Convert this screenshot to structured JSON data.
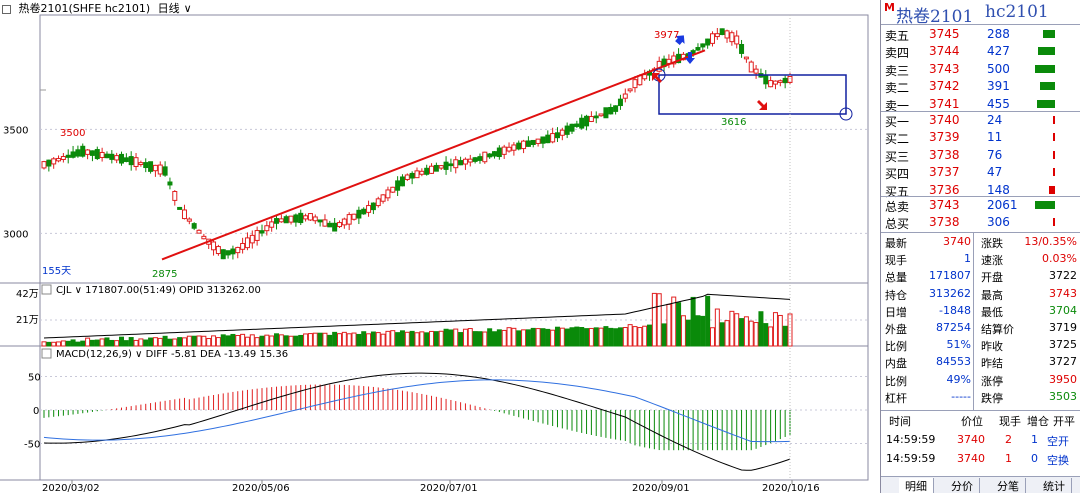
{
  "title": {
    "name": "热卷2101(SHFE hc2101)",
    "period": "日线",
    "arrow": "chevron-down-icon"
  },
  "chart_data": {
    "type": "candlestick",
    "x_ticks": [
      "2020/03/02",
      "2020/05/06",
      "2020/07/01",
      "2020/09/01",
      "2020/10/16"
    ],
    "price_axis": {
      "ticks": [
        "3500",
        "3000"
      ],
      "range": [
        2800,
        4050
      ]
    },
    "annotations": {
      "high1": "3500",
      "low": "2875",
      "high2": "3977",
      "box_low": "3616",
      "days": "155天"
    },
    "volume": {
      "label": "CJL",
      "value": "171807.00(51:49)",
      "opi_label": "OPID",
      "opi_value": "313262.00",
      "ticks": [
        "42万",
        "21万"
      ]
    },
    "macd": {
      "label": "MACD(12,26,9)",
      "diff_label": "DIFF",
      "diff": "-5.81",
      "dea_label": "DEA",
      "dea": "-13.49",
      "hist": "15.36",
      "ticks": [
        "50",
        "0",
        "-50"
      ]
    },
    "colors": {
      "up": "#e02020",
      "down": "#0a8a0a",
      "trend": "#e01010",
      "box": "#1020a0",
      "vol_line": "#000000",
      "diff_line": "#000000",
      "dea_line": "#3070e0"
    }
  },
  "panel": {
    "title_marker": "M",
    "title": "热卷2101",
    "code": "hc2101",
    "asks": [
      {
        "label": "卖五",
        "price": "3745",
        "vol": "288",
        "bar": 0.55
      },
      {
        "label": "卖四",
        "price": "3744",
        "vol": "427",
        "bar": 0.75
      },
      {
        "label": "卖三",
        "price": "3743",
        "vol": "500",
        "bar": 0.9
      },
      {
        "label": "卖二",
        "price": "3742",
        "vol": "391",
        "bar": 0.7
      },
      {
        "label": "卖一",
        "price": "3741",
        "vol": "455",
        "bar": 0.8
      }
    ],
    "bids": [
      {
        "label": "买一",
        "price": "3740",
        "vol": "24",
        "bar": 0.04
      },
      {
        "label": "买二",
        "price": "3739",
        "vol": "11",
        "bar": 0.02
      },
      {
        "label": "买三",
        "price": "3738",
        "vol": "76",
        "bar": 0.1
      },
      {
        "label": "买四",
        "price": "3737",
        "vol": "47",
        "bar": 0.07
      },
      {
        "label": "买五",
        "price": "3736",
        "vol": "148",
        "bar": 0.25
      }
    ],
    "totals": [
      {
        "label": "总卖",
        "price": "3743",
        "vol": "2061",
        "bar": 0.9
      },
      {
        "label": "总买",
        "price": "3738",
        "vol": "306",
        "bar": 0.05
      }
    ],
    "stats_left": [
      {
        "label": "最新",
        "value": "3740",
        "color": "#d00"
      },
      {
        "label": "现手",
        "value": "1",
        "color": "#0033cc"
      },
      {
        "label": "总量",
        "value": "171807",
        "color": "#0033cc"
      },
      {
        "label": "持仓",
        "value": "313262",
        "color": "#0033cc"
      },
      {
        "label": "日增",
        "value": "-1848",
        "color": "#0033cc"
      },
      {
        "label": "外盘",
        "value": "87254",
        "color": "#0033cc"
      },
      {
        "label": "比例",
        "value": "51%",
        "color": "#0033cc"
      },
      {
        "label": "内盘",
        "value": "84553",
        "color": "#0033cc"
      },
      {
        "label": "比例",
        "value": "49%",
        "color": "#0033cc"
      },
      {
        "label": "杠杆",
        "value": "-----",
        "color": "#0033cc"
      }
    ],
    "stats_right": [
      {
        "label": "涨跌",
        "value": "13/0.35%",
        "color": "#d00"
      },
      {
        "label": "速涨",
        "value": "0.03%",
        "color": "#d00"
      },
      {
        "label": "开盘",
        "value": "3722",
        "color": "#000"
      },
      {
        "label": "最高",
        "value": "3743",
        "color": "#d00"
      },
      {
        "label": "最低",
        "value": "3704",
        "color": "#0a8a0a"
      },
      {
        "label": "结算价",
        "value": "3719",
        "color": "#000"
      },
      {
        "label": "昨收",
        "value": "3725",
        "color": "#000"
      },
      {
        "label": "昨结",
        "value": "3727",
        "color": "#000"
      },
      {
        "label": "涨停",
        "value": "3950",
        "color": "#d00"
      },
      {
        "label": "跌停",
        "value": "3503",
        "color": "#0a8a0a"
      }
    ],
    "ticks_header": {
      "time": "时间",
      "price": "价位",
      "qty": "现手",
      "oi": "增仓",
      "type": "开平"
    },
    "ticks": [
      {
        "time": "14:59:59",
        "price": "3740",
        "qty": "2",
        "oi": "1",
        "type": "空开"
      },
      {
        "time": "14:59:59",
        "price": "3740",
        "qty": "1",
        "oi": "0",
        "type": "空换"
      }
    ],
    "tabs": [
      "明细",
      "分价",
      "分笔",
      "统计"
    ]
  }
}
